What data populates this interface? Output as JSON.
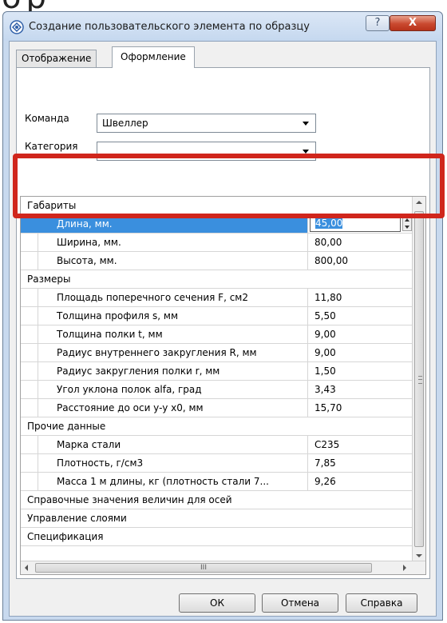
{
  "window": {
    "title": "Создание пользовательского элемента по образцу",
    "help_label": "?",
    "close_label": "X"
  },
  "tabs": [
    {
      "label": "Отображение",
      "active": false
    },
    {
      "label": "Оформление",
      "active": true
    }
  ],
  "fields": {
    "command_label": "Команда",
    "command_value": "Швеллер",
    "category_label": "Категория",
    "category_value": ""
  },
  "grid": {
    "rows": [
      {
        "type": "category",
        "name": "Габариты"
      },
      {
        "type": "prop",
        "name": "Длина, мм.",
        "value": "45,00",
        "selected": true
      },
      {
        "type": "prop",
        "name": "Ширина, мм.",
        "value": "80,00"
      },
      {
        "type": "prop",
        "name": "Высота, мм.",
        "value": "800,00"
      },
      {
        "type": "category",
        "name": "Размеры"
      },
      {
        "type": "prop",
        "name": "Площадь поперечного сечения F, см2",
        "value": "11,80"
      },
      {
        "type": "prop",
        "name": "Толщина профиля s, мм",
        "value": "5,50"
      },
      {
        "type": "prop",
        "name": "Толщина полки t, мм",
        "value": "9,00"
      },
      {
        "type": "prop",
        "name": "Радиус внутреннего закругления R, мм",
        "value": "9,00"
      },
      {
        "type": "prop",
        "name": "Радиус закругления полки r, мм",
        "value": "1,50"
      },
      {
        "type": "prop",
        "name": "Угол уклона полок alfa, град",
        "value": "3,43"
      },
      {
        "type": "prop",
        "name": "Расстояние до оси y-y x0, мм",
        "value": "15,70"
      },
      {
        "type": "category",
        "name": "Прочие данные"
      },
      {
        "type": "prop",
        "name": "Марка стали",
        "value": "С235"
      },
      {
        "type": "prop",
        "name": "Плотность, г/см3",
        "value": "7,85"
      },
      {
        "type": "prop",
        "name": "Масса 1 м длины, кг (плотность стали 7...",
        "value": "9,26"
      },
      {
        "type": "category",
        "name": "Справочные значения величин для осей"
      },
      {
        "type": "category",
        "name": "Управление слоями"
      },
      {
        "type": "category",
        "name": "Спецификация"
      }
    ],
    "hscroll_grip": "III"
  },
  "buttons": {
    "ok": "ОК",
    "cancel": "Отмена",
    "help": "Справка"
  },
  "colors": {
    "selection": "#3a8fde",
    "highlight_frame": "#d0261c"
  },
  "background_fragment": "ор"
}
